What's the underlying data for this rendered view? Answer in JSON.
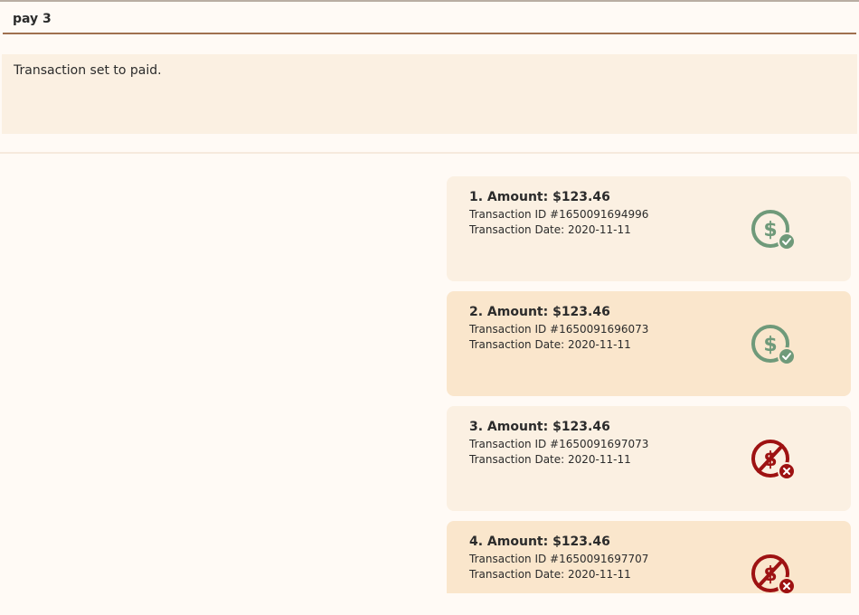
{
  "command": {
    "value": "pay 3"
  },
  "result": {
    "message": "Transaction set to paid."
  },
  "transactions": [
    {
      "title": "1. Amount: $123.46",
      "id_line": "Transaction ID #1650091694996",
      "date_line": "Transaction Date: 2020-11-11",
      "status": "paid",
      "icon": "dollar-paid-icon"
    },
    {
      "title": "2. Amount: $123.46",
      "id_line": "Transaction ID #1650091696073",
      "date_line": "Transaction Date: 2020-11-11",
      "status": "paid",
      "icon": "dollar-paid-icon"
    },
    {
      "title": "3. Amount: $123.46",
      "id_line": "Transaction ID #1650091697073",
      "date_line": "Transaction Date: 2020-11-11",
      "status": "unpaid",
      "icon": "dollar-unpaid-icon"
    },
    {
      "title": "4. Amount: $123.46",
      "id_line": "Transaction ID #1650091697707",
      "date_line": "Transaction Date: 2020-11-11",
      "status": "unpaid",
      "icon": "dollar-unpaid-icon"
    }
  ],
  "colors": {
    "paid": "#6f9a7a",
    "unpaid": "#9e1212",
    "accent_border": "#a0704f",
    "card_light": "#fbf0e2",
    "card_dark": "#fae6cc"
  }
}
